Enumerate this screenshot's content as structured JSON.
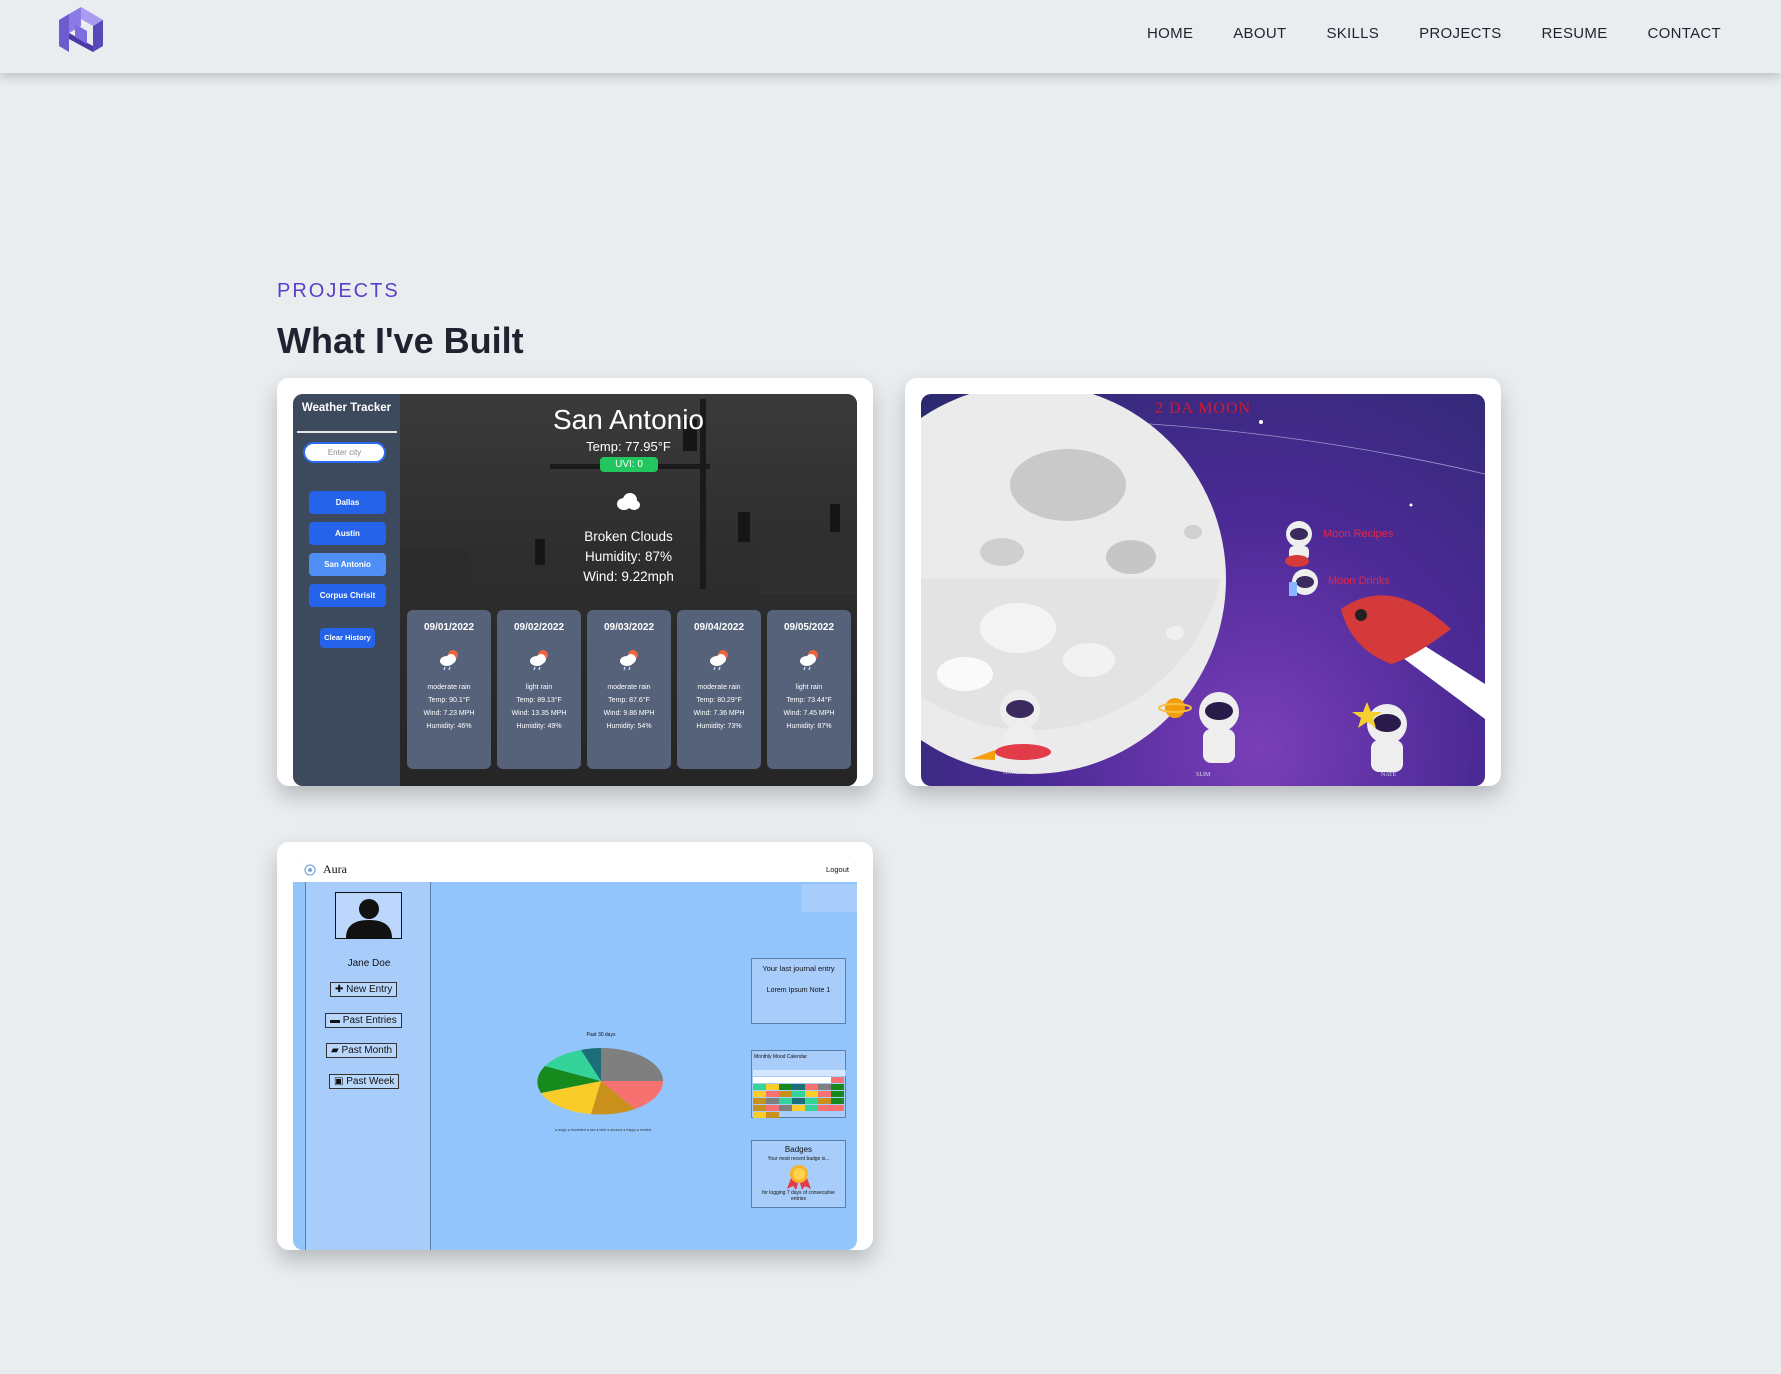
{
  "nav": {
    "items": [
      "HOME",
      "ABOUT",
      "SKILLS",
      "PROJECTS",
      "RESUME",
      "CONTACT"
    ]
  },
  "section": {
    "eyebrow": "PROJECTS",
    "title": "What I've Built"
  },
  "weather_app": {
    "title": "Weather Tracker",
    "search_placeholder": "Enter city",
    "history": [
      "Dallas",
      "Austin",
      "San Antonio",
      "Corpus Chrisit"
    ],
    "clear_label": "Clear History",
    "city": "San Antonio",
    "temp": "Temp: 77.95°F",
    "uvi": "UVI: 0",
    "condition": "Broken Clouds",
    "humidity": "Humidity: 87%",
    "wind": "Wind: 9.22mph",
    "forecast": [
      {
        "date": "09/01/2022",
        "desc": "moderate rain",
        "temp": "Temp: 90.1°F",
        "wind": "Wind: 7.23 MPH",
        "humidity": "Humidity: 46%"
      },
      {
        "date": "09/02/2022",
        "desc": "light rain",
        "temp": "Temp: 89.13°F",
        "wind": "Wind: 13.35 MPH",
        "humidity": "Humidity: 49%"
      },
      {
        "date": "09/03/2022",
        "desc": "moderate rain",
        "temp": "Temp: 87.6°F",
        "wind": "Wind: 9.86 MPH",
        "humidity": "Humidity: 54%"
      },
      {
        "date": "09/04/2022",
        "desc": "moderate rain",
        "temp": "Temp: 80.29°F",
        "wind": "Wind: 7.36 MPH",
        "humidity": "Humidity: 73%"
      },
      {
        "date": "09/05/2022",
        "desc": "light rain",
        "temp": "Temp: 73.44°F",
        "wind": "Wind: 7.45 MPH",
        "humidity": "Humidity: 87%"
      }
    ]
  },
  "moon_app": {
    "title": "2 DA MOON",
    "links": [
      "Moon Recipes",
      "Moon Drinks"
    ],
    "names": [
      "ANGEL",
      "SLIM",
      "NATE"
    ]
  },
  "aura_app": {
    "brand": "Aura",
    "logout": "Logout",
    "user": "Jane Doe",
    "buttons": [
      "New Entry",
      "Past Entries",
      "Past Month",
      "Past Week"
    ],
    "chart_title": "Past 30 days",
    "journal_title": "Your last journal entry",
    "journal_note": "Lorem Ipsum Note 1",
    "calendar_title": "Monthly Mood Calendar",
    "badges_title": "Badges",
    "badges_sub": "Your most recent badge is...",
    "badges_desc": "for logging 7 days of consecutive entries"
  },
  "colors": {
    "accent": "#5b3fc8",
    "text": "#1f2330",
    "background": "#e9edf0"
  }
}
